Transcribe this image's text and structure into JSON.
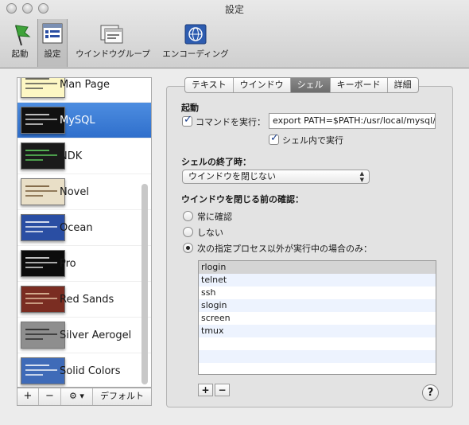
{
  "window": {
    "title": "設定"
  },
  "toolbar": {
    "items": [
      {
        "label": "起動",
        "icon": "startup-flag-icon"
      },
      {
        "label": "設定",
        "icon": "settings-window-icon"
      },
      {
        "label": "ウインドウグループ",
        "icon": "window-group-icon"
      },
      {
        "label": "エンコーディング",
        "icon": "encoding-globe-icon"
      }
    ],
    "selected": "設定"
  },
  "profiles": {
    "items": [
      {
        "name": "Man Page",
        "bg": "#fdf7c4",
        "fg": "#444444"
      },
      {
        "name": "MySQL",
        "bg": "#111111",
        "fg": "#e8e8e8"
      },
      {
        "name": "NDK",
        "bg": "#1b1b1b",
        "fg": "#5fd35f"
      },
      {
        "name": "Novel",
        "bg": "#e9dfc7",
        "fg": "#6b4f2c"
      },
      {
        "name": "Ocean",
        "bg": "#2a4ea3",
        "fg": "#ffffff"
      },
      {
        "name": "Pro",
        "bg": "#0c0c0c",
        "fg": "#eeeeee"
      },
      {
        "name": "Red Sands",
        "bg": "#7a2d22",
        "fg": "#e9c9a8"
      },
      {
        "name": "Silver Aerogel",
        "bg": "#8e8e8e",
        "fg": "#222222"
      },
      {
        "name": "Solid Colors",
        "bg": "#3f6bb8",
        "fg": "#ffffff"
      }
    ],
    "selected": "MySQL",
    "buttons": {
      "add": "+",
      "remove": "−",
      "gear": "⚙ ▾",
      "default": "デフォルト"
    }
  },
  "tabs": [
    "テキスト",
    "ウインドウ",
    "シェル",
    "キーボード",
    "詳細"
  ],
  "active_tab": "シェル",
  "startup": {
    "heading": "起動",
    "run_command_label": "コマンドを実行：",
    "run_command_checked": true,
    "command_value": "export PATH=$PATH:/usr/local/mysql/bin",
    "run_in_shell_label": "シェル内で実行",
    "run_in_shell_checked": true
  },
  "shell_exit": {
    "heading": "シェルの終了時：",
    "selected": "ウインドウを閉じない"
  },
  "confirm_close": {
    "heading": "ウインドウを閉じる前の確認：",
    "options": [
      "常に確認",
      "しない",
      "次の指定プロセス以外が実行中の場合のみ："
    ],
    "selected_index": 2,
    "processes": [
      "rlogin",
      "telnet",
      "ssh",
      "slogin",
      "screen",
      "tmux"
    ],
    "add": "+",
    "remove": "−"
  },
  "help": "?"
}
